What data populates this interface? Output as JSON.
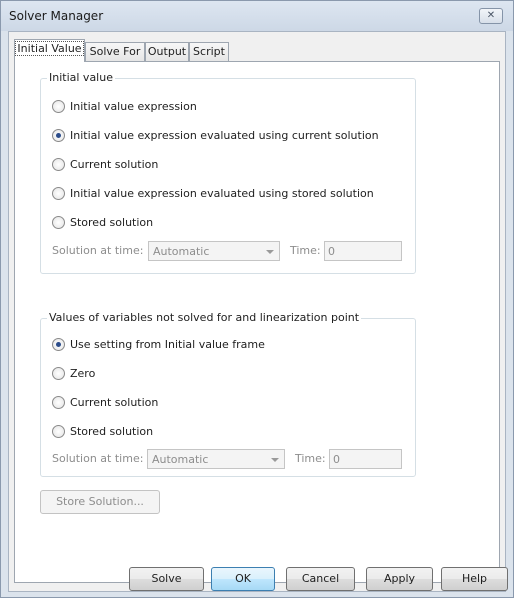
{
  "window": {
    "title": "Solver Manager",
    "close_glyph": "✕"
  },
  "tabs": [
    {
      "label": "Initial Value",
      "active": true
    },
    {
      "label": "Solve For",
      "active": false
    },
    {
      "label": "Output",
      "active": false
    },
    {
      "label": "Script",
      "active": false
    }
  ],
  "initial_value_group": {
    "title": "Initial value",
    "options": [
      {
        "label": "Initial value expression",
        "checked": false
      },
      {
        "label": "Initial value expression evaluated using current solution",
        "checked": true
      },
      {
        "label": "Current solution",
        "checked": false
      },
      {
        "label": "Initial value expression evaluated using stored solution",
        "checked": false
      },
      {
        "label": "Stored solution",
        "checked": false
      }
    ],
    "solution_at_time_label": "Solution at time:",
    "solution_at_time_value": "Automatic",
    "time_label": "Time:",
    "time_value": "0"
  },
  "linearization_group": {
    "title": "Values of variables not solved for and linearization point",
    "options": [
      {
        "label": "Use setting from Initial value frame",
        "checked": true
      },
      {
        "label": "Zero",
        "checked": false
      },
      {
        "label": "Current solution",
        "checked": false
      },
      {
        "label": "Stored solution",
        "checked": false
      }
    ],
    "solution_at_time_label": "Solution at time:",
    "solution_at_time_value": "Automatic",
    "time_label": "Time:",
    "time_value": "0"
  },
  "store_solution_label": "Store Solution...",
  "buttons": {
    "solve": "Solve",
    "ok": "OK",
    "cancel": "Cancel",
    "apply": "Apply",
    "help": "Help"
  },
  "icons": {
    "close": "close-icon",
    "combo_arrow": "chevron-down-icon"
  },
  "colors": {
    "default_button": "#3c7fb1",
    "radio_dot": "#2b4c8a",
    "disabled_text": "#8d8d8d"
  }
}
